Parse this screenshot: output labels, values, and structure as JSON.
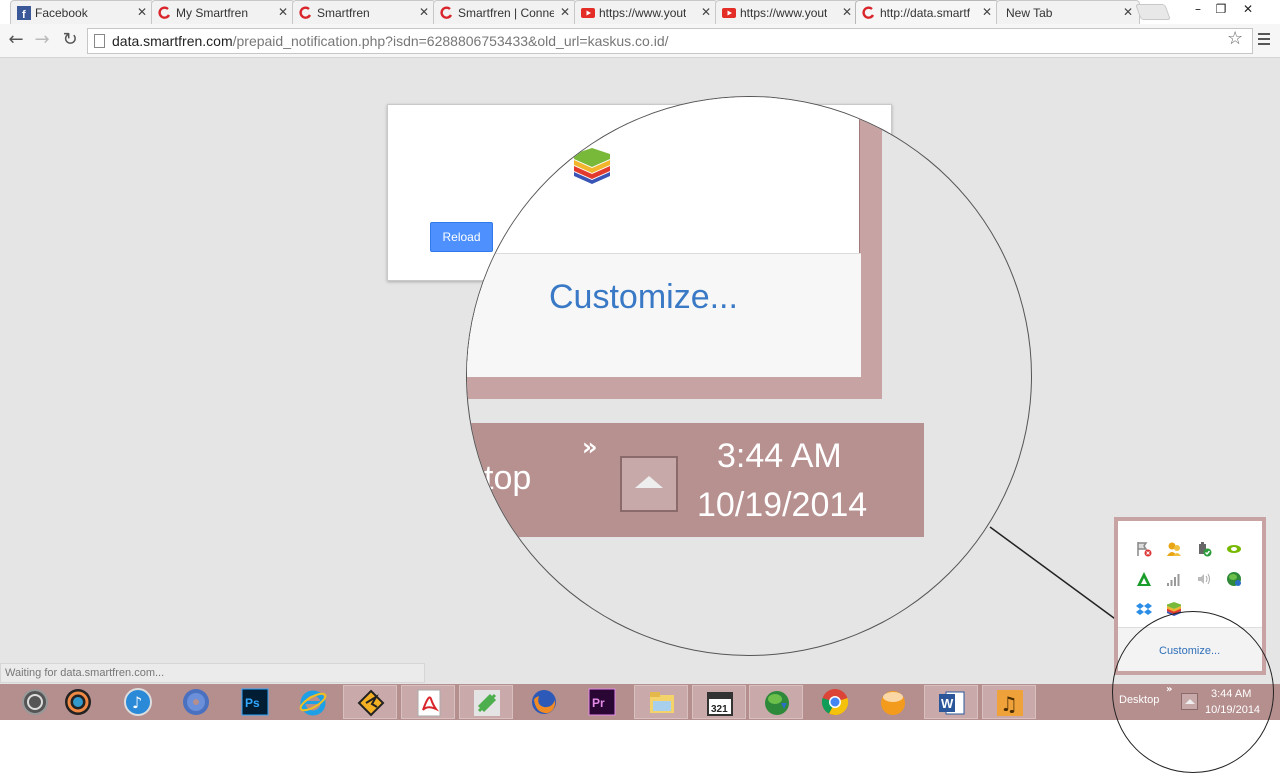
{
  "tabs": [
    {
      "title": "Facebook",
      "icon": "facebook-icon",
      "active": false
    },
    {
      "title": "My Smartfren",
      "icon": "smartfren-icon",
      "active": false
    },
    {
      "title": "Smartfren",
      "icon": "smartfren-icon",
      "active": false
    },
    {
      "title": "Smartfren | Conne",
      "icon": "smartfren-icon",
      "active": false
    },
    {
      "title": "https://www.yout",
      "icon": "youtube-icon",
      "active": false
    },
    {
      "title": "https://www.yout",
      "icon": "youtube-icon",
      "active": false
    },
    {
      "title": "http://data.smartf",
      "icon": "smartfren-icon",
      "active": true
    },
    {
      "title": "New Tab",
      "icon": "",
      "active": false
    }
  ],
  "window_controls": {
    "minimize": "–",
    "restore": "❐",
    "close": "✕"
  },
  "omnibox": {
    "host": "data.smartfren.com",
    "path": "/prepaid_notification.php?isdn=6288806753433&old_url=kaskus.co.id/"
  },
  "page": {
    "reload_label": "Reload",
    "status_text": "Waiting for data.smartfren.com..."
  },
  "magnifier": {
    "customize_label": "Customize...",
    "desktop_label": "ktop",
    "chevron": "»",
    "time": "3:44 AM",
    "date": "10/19/2014"
  },
  "tray_popup": {
    "customize_label": "Customize...",
    "icons": [
      "action-center-icon",
      "user-accounts-icon",
      "power-icon",
      "nvidia-icon",
      "network-triangle-icon",
      "signal-bars-icon",
      "volume-icon",
      "globe-update-icon",
      "dropbox-icon",
      "bluestacks-icon"
    ]
  },
  "taskbar": {
    "desktop_label": "Desktop",
    "chevron": "»",
    "time": "3:44 AM",
    "date": "10/19/2014",
    "apps": [
      "windows-orb-icon",
      "camera-icon",
      "itunes-icon",
      "disc-icon",
      "photoshop-icon",
      "internet-explorer-icon",
      "winamp-icon",
      "acrobat-icon",
      "vine-icon",
      "firefox-icon",
      "premiere-icon",
      "file-explorer-icon",
      "media-player-321-icon",
      "download-manager-icon",
      "chrome-icon",
      "orange-globe-icon",
      "word-icon",
      "music-icon"
    ]
  },
  "colors": {
    "taskbar": "#b58e8e",
    "accent_blue": "#4d90fe",
    "link_blue": "#3979c5"
  }
}
